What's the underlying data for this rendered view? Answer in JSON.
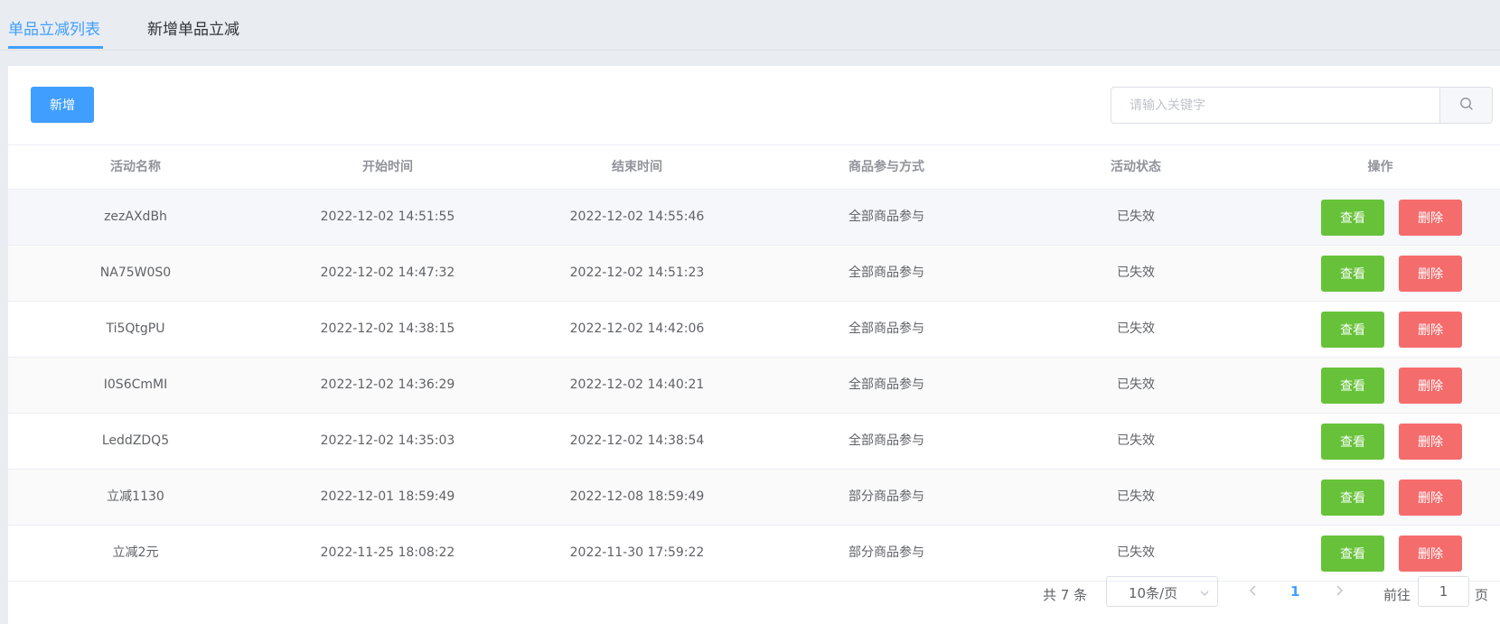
{
  "tabs": [
    {
      "label": "单品立减列表"
    },
    {
      "label": "新增单品立减"
    }
  ],
  "toolbar": {
    "add_label": "新增",
    "search_placeholder": "请输入关键字",
    "search_value": ""
  },
  "table": {
    "headers": [
      "活动名称",
      "开始时间",
      "结束时间",
      "商品参与方式",
      "活动状态",
      "操作"
    ],
    "rows": [
      {
        "name": "zezAXdBh",
        "start": "2022-12-02 14:51:55",
        "end": "2022-12-02 14:55:46",
        "mode": "全部商品参与",
        "status": "已失效"
      },
      {
        "name": "NA75W0S0",
        "start": "2022-12-02 14:47:32",
        "end": "2022-12-02 14:51:23",
        "mode": "全部商品参与",
        "status": "已失效"
      },
      {
        "name": "Ti5QtgPU",
        "start": "2022-12-02 14:38:15",
        "end": "2022-12-02 14:42:06",
        "mode": "全部商品参与",
        "status": "已失效"
      },
      {
        "name": "I0S6CmMI",
        "start": "2022-12-02 14:36:29",
        "end": "2022-12-02 14:40:21",
        "mode": "全部商品参与",
        "status": "已失效"
      },
      {
        "name": "LeddZDQ5",
        "start": "2022-12-02 14:35:03",
        "end": "2022-12-02 14:38:54",
        "mode": "全部商品参与",
        "status": "已失效"
      },
      {
        "name": "立减1130",
        "start": "2022-12-01 18:59:49",
        "end": "2022-12-08 18:59:49",
        "mode": "部分商品参与",
        "status": "已失效"
      },
      {
        "name": "立减2元",
        "start": "2022-11-25 18:08:22",
        "end": "2022-11-30 17:59:22",
        "mode": "部分商品参与",
        "status": "已失效"
      }
    ],
    "view_label": "查看",
    "delete_label": "删除"
  },
  "pagination": {
    "total_text": "共 7 条",
    "page_size": "10条/页",
    "current_page": "1",
    "goto_label": "前往",
    "goto_value": "1",
    "goto_suffix": "页"
  },
  "colors": {
    "primary": "#409eff",
    "view": "#67c23a",
    "delete": "#f56c6c"
  },
  "icons": {
    "search": "search-icon",
    "dropdown": "chevron-down-icon",
    "prev": "chevron-left-icon",
    "next": "chevron-right-icon"
  }
}
